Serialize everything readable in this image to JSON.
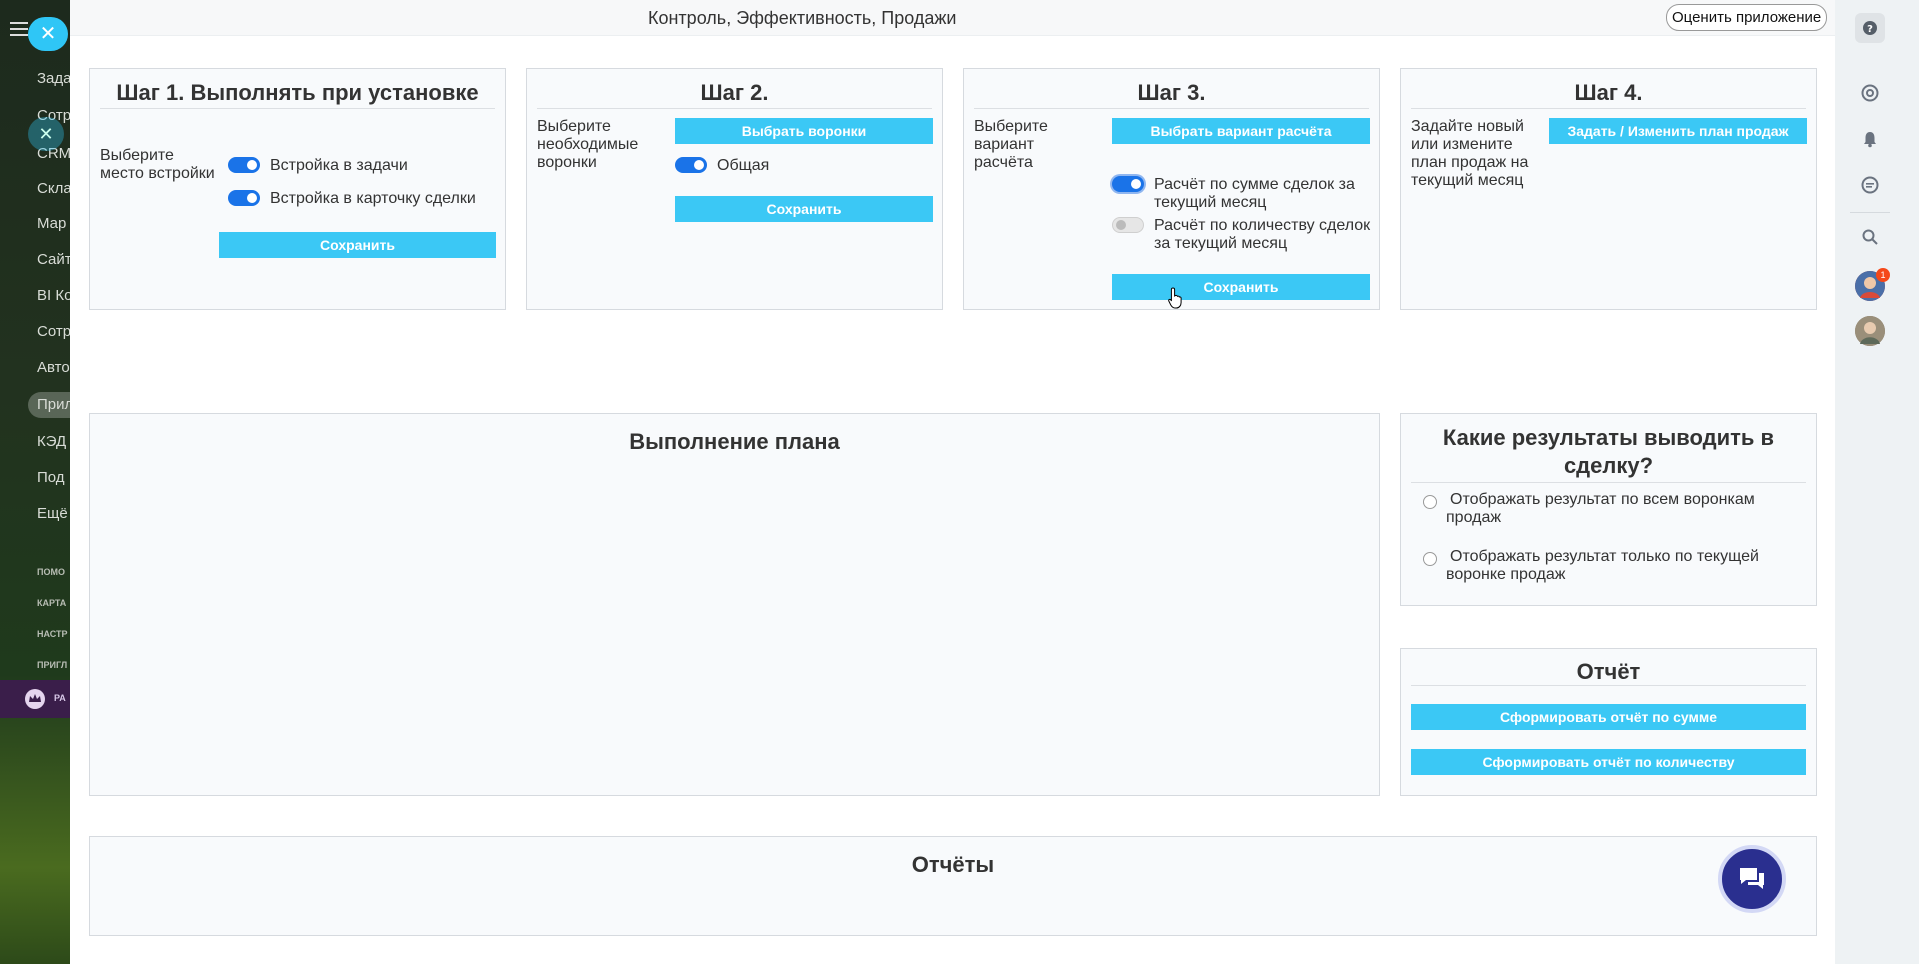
{
  "header": {
    "title": "Контроль, Эффективность, Продажи",
    "rate_button": "Оценить приложение"
  },
  "left_menu": {
    "items": [
      "Зада",
      "Сотр",
      "СRM",
      "Скла",
      "Мар",
      "Сайт",
      "BI Ко",
      "Сотр",
      "Авто",
      "Прил",
      "КЭД",
      "Под",
      "Ещё"
    ],
    "small_items": [
      "ПОМО",
      "КАРТА",
      "НАСТР",
      "ПРИГЛ"
    ],
    "promo": "РА"
  },
  "step1": {
    "title": "Шаг 1. Выполнять при установке",
    "desc": "Выберите место встройки",
    "opt1": "Встройка в задачи",
    "opt2": "Встройка в карточку сделки",
    "save": "Сохранить"
  },
  "step2": {
    "title": "Шаг 2.",
    "desc": "Выберите необходимые воронки",
    "choose": "Выбрать воронки",
    "opt1": "Общая",
    "save": "Сохранить"
  },
  "step3": {
    "title": "Шаг 3.",
    "desc": "Выберите вариант расчёта",
    "choose": "Выбрать вариант расчёта",
    "opt1": "Расчёт по сумме сделок за текущий месяц",
    "opt2": "Расчёт по количеству сделок за текущий месяц",
    "save": "Сохранить"
  },
  "step4": {
    "title": "Шаг 4.",
    "desc": "Задайте новый или измените план продаж на текущий месяц",
    "set_plan": "Задать / Изменить план продаж"
  },
  "plan": {
    "title": "Выполнение плана"
  },
  "results": {
    "title": "Какие результаты выводить в сделку?",
    "opt1": "Отображать результат по всем воронкам продаж",
    "opt2": "Отображать результат только по текущей воронке продаж"
  },
  "report": {
    "title": "Отчёт",
    "by_sum": "Сформировать отчёт по сумме",
    "by_count": "Сформировать отчёт по количеству"
  },
  "reports": {
    "title": "Отчёты"
  },
  "right_bar": {
    "badge": "1"
  },
  "colors": {
    "accent": "#3bc8f5",
    "toggle_on": "#1a73e8",
    "chat": "#2a2f8f"
  }
}
